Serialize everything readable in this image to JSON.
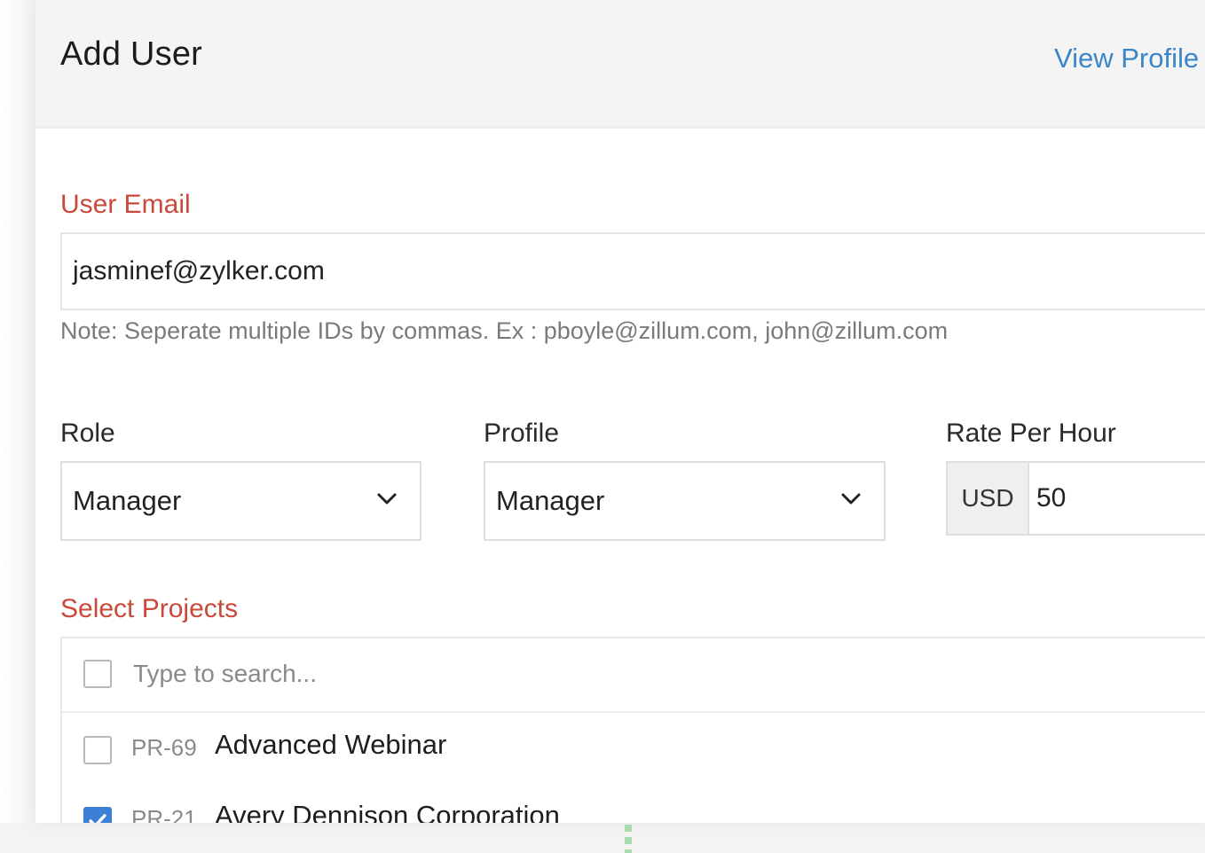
{
  "dialog": {
    "title": "Add User",
    "view_profile_link": "View Profile"
  },
  "email": {
    "label": "User Email",
    "value": "jasminef@zylker.com",
    "note": "Note: Seperate multiple IDs by commas. Ex : pboyle@zillum.com, john@zillum.com"
  },
  "role": {
    "label": "Role",
    "selected": "Manager"
  },
  "profile": {
    "label": "Profile",
    "selected": "Manager"
  },
  "rate": {
    "label": "Rate Per Hour",
    "currency": "USD",
    "value": "50"
  },
  "projects": {
    "label": "Select Projects",
    "search_placeholder": "Type to search...",
    "items": [
      {
        "code": "PR-69",
        "name": "Advanced Webinar",
        "checked": false
      },
      {
        "code": "PR-21",
        "name": "Avery Dennison Corporation",
        "checked": true
      }
    ]
  },
  "colors": {
    "required_label": "#c94a3a",
    "link": "#3a86c8",
    "checkbox_checked": "#3c7fd6"
  }
}
